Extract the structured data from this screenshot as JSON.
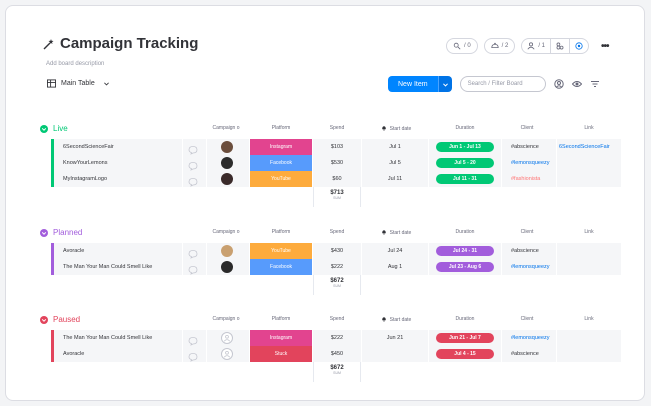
{
  "header": {
    "title": "Campaign Tracking",
    "subtitle": "Add board description",
    "activity_count": "/ 0",
    "updates_count": "/ 2",
    "members_count": "/ 1"
  },
  "toolbar": {
    "view_label": "Main Table",
    "new_item_label": "New Item",
    "search_placeholder": "Search / Filter Board"
  },
  "columns": {
    "campaign_owner": "Campaign o",
    "platform": "Platform",
    "spend": "Spend",
    "start_date": "Start date",
    "duration": "Duration",
    "client": "Client",
    "link": "Link"
  },
  "colors": {
    "live": "#00c875",
    "planned": "#a25ddc",
    "paused": "#e2445c",
    "instagram": "#e2448f",
    "facebook": "#579bfc",
    "youtube": "#fdab3d",
    "stuck": "#e2445c",
    "link": "#0073ea",
    "fashion": "#ff7575"
  },
  "groups": [
    {
      "title": "Live",
      "rows": [
        {
          "name": "6SecondScienceFair",
          "platform": "Instagram",
          "spend": "$103",
          "start": "Jul 1",
          "duration": "Jun 1 - Jul 13",
          "client": "#abscience",
          "link": "6SecondScienceFair"
        },
        {
          "name": "KnowYourLemons",
          "platform": "Facebook",
          "spend": "$530",
          "start": "Jul 5",
          "duration": "Jul 5 - 20",
          "client": "#lemonsqueezy",
          "link": ""
        },
        {
          "name": "MyInstagramLogo",
          "platform": "YouTube",
          "spend": "$60",
          "start": "Jul 11",
          "duration": "Jul 11 - 31",
          "client": "#fashionista",
          "link": ""
        }
      ],
      "total": "$713",
      "total_label": "SUM"
    },
    {
      "title": "Planned",
      "rows": [
        {
          "name": "Avoracle",
          "platform": "YouTube",
          "spend": "$430",
          "start": "Jul 24",
          "duration": "Jul 24 - 31",
          "client": "#abscience",
          "link": ""
        },
        {
          "name": "The Man Your Man Could Smell Like",
          "platform": "Facebook",
          "spend": "$222",
          "start": "Aug 1",
          "duration": "Jul 23 - Aug 6",
          "client": "#lemonsqueezy",
          "link": ""
        }
      ],
      "total": "$672",
      "total_label": "SUM"
    },
    {
      "title": "Paused",
      "rows": [
        {
          "name": "The Man Your Man Could Smell Like",
          "platform": "Instagram",
          "spend": "$222",
          "start": "Jun 21",
          "duration": "Jun 21 - Jul 7",
          "client": "#lemonsqueezy",
          "link": ""
        },
        {
          "name": "Avoracle",
          "platform": "Stuck",
          "spend": "$450",
          "start": "",
          "duration": "Jul 4 - 15",
          "client": "#abscience",
          "link": ""
        }
      ],
      "total": "$672",
      "total_label": "SUM"
    }
  ]
}
